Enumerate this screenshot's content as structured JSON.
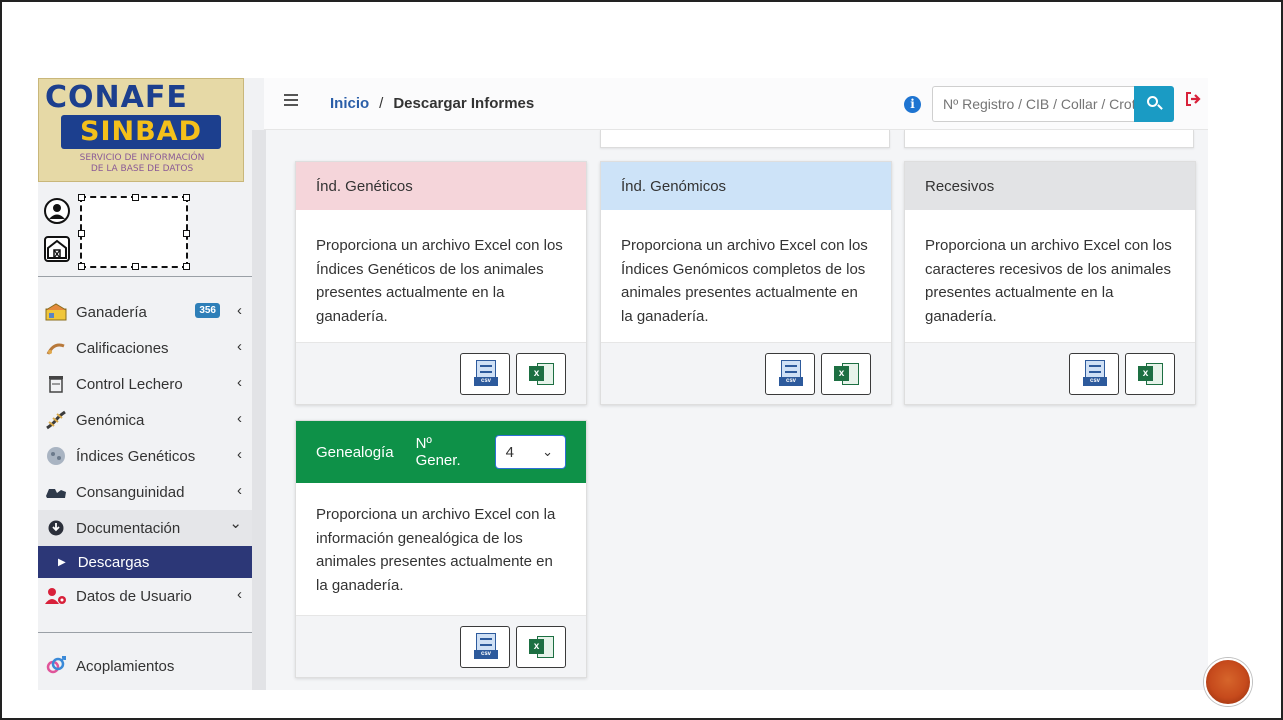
{
  "logo": {
    "line1": "CONAFE",
    "line2": "SINBAD",
    "line3": "SERVICIO DE INFORMACIÓN",
    "line4": "DE LA BASE DE DATOS"
  },
  "sidebar": {
    "items": [
      {
        "label": "Ganadería",
        "icon": "herd-icon",
        "badge": "356",
        "chevron": "‹"
      },
      {
        "label": "Calificaciones",
        "icon": "rating-icon",
        "chevron": "‹"
      },
      {
        "label": "Control Lechero",
        "icon": "milk-control-icon",
        "chevron": "‹"
      },
      {
        "label": "Genómica",
        "icon": "dna-icon",
        "chevron": "‹"
      },
      {
        "label": "Índices Genéticos",
        "icon": "genetic-index-icon",
        "chevron": "‹"
      },
      {
        "label": "Consanguinidad",
        "icon": "consanguinity-icon",
        "chevron": "‹"
      },
      {
        "label": "Documentación",
        "icon": "download-circle-icon",
        "chevron": "⌄"
      },
      {
        "label": "Descargas",
        "icon": "caret-right-icon"
      },
      {
        "label": "Datos de Usuario",
        "icon": "user-gear-icon",
        "chevron": "‹"
      }
    ],
    "footer_item": {
      "label": "Acoplamientos",
      "icon": "gender-icon"
    }
  },
  "topbar": {
    "breadcrumb_home": "Inicio",
    "breadcrumb_separator": "/",
    "breadcrumb_current": "Descargar Informes",
    "search_placeholder": "Nº Registro / CIB / Collar / Crotal"
  },
  "cards": [
    {
      "title": "Índ. Genéticos",
      "header_color": "#f5d5da",
      "text": "Proporciona un archivo Excel con los Índices Genéticos de los animales presentes actualmente en la ganadería."
    },
    {
      "title": "Índ. Genómicos",
      "header_color": "#cde3f8",
      "text": "Proporciona un archivo Excel con los Índices Genómicos completos de los animales presentes actualmente en la ganadería."
    },
    {
      "title": "Recesivos",
      "header_color": "#e2e3e5",
      "text": "Proporciona un archivo Excel con los caracteres recesivos de los animales presentes actualmente en la ganadería."
    },
    {
      "title": "Genealogía",
      "header_color": "#0e9148",
      "generations_label": "Nº Gener.",
      "generations_value": "4",
      "text": "Proporciona un archivo Excel con la información genealógica de los animales presentes actualmente en la ganadería."
    }
  ],
  "buttons": {
    "csv_tag": "csv",
    "excel_letter": "x"
  },
  "colors": {
    "accent": "#1a9bc4",
    "sidebar_active": "#2c3777",
    "link": "#2a5ea8",
    "logout": "#d8213a"
  }
}
